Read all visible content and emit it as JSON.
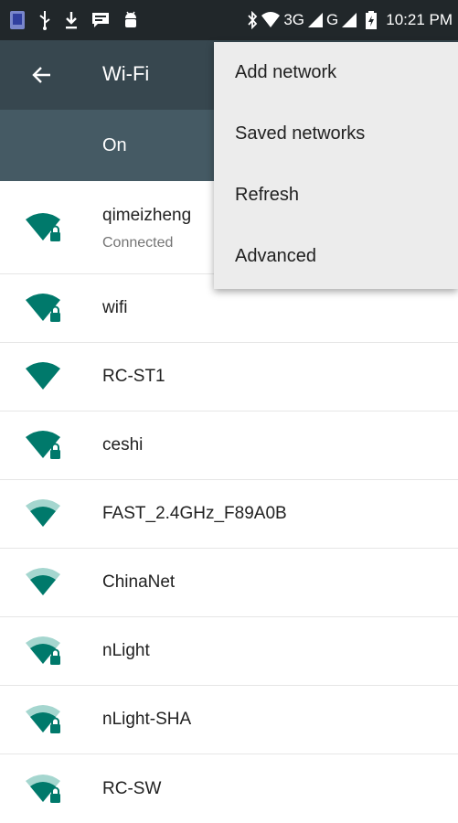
{
  "status_bar": {
    "icons_left": [
      "phone-app-icon",
      "usb-icon",
      "download-icon",
      "message-icon",
      "android-debug-icon"
    ],
    "icons_right": [
      "bluetooth-icon",
      "wifi-status-icon",
      "signal-3g-icon",
      "signal-g-icon",
      "battery-icon"
    ],
    "network_3g": "3G",
    "network_g": "G",
    "time": "10:21 PM"
  },
  "app_bar": {
    "title": "Wi-Fi",
    "back_icon": "back-arrow-icon"
  },
  "toggle": {
    "state_label": "On"
  },
  "networks": [
    {
      "name": "qimeizheng",
      "status": "Connected",
      "secured": true,
      "strength": "full"
    },
    {
      "name": "wifi",
      "secured": true,
      "strength": "full"
    },
    {
      "name": "RC-ST1",
      "secured": false,
      "strength": "full"
    },
    {
      "name": "ceshi",
      "secured": true,
      "strength": "full"
    },
    {
      "name": "FAST_2.4GHz_F89A0B",
      "secured": false,
      "strength": "medium"
    },
    {
      "name": "ChinaNet",
      "secured": false,
      "strength": "medium"
    },
    {
      "name": "nLight",
      "secured": true,
      "strength": "medium"
    },
    {
      "name": "nLight-SHA",
      "secured": true,
      "strength": "medium"
    },
    {
      "name": "RC-SW",
      "secured": true,
      "strength": "medium"
    }
  ],
  "overflow_menu": {
    "items": [
      "Add network",
      "Saved networks",
      "Refresh",
      "Advanced"
    ]
  },
  "colors": {
    "status_bar": "#21272a",
    "app_bar": "#37474f",
    "toggle_strip": "#455a64",
    "wifi_icon": "#00796b",
    "wifi_icon_weak": "#a5d6cf",
    "menu_bg": "#ececec"
  }
}
